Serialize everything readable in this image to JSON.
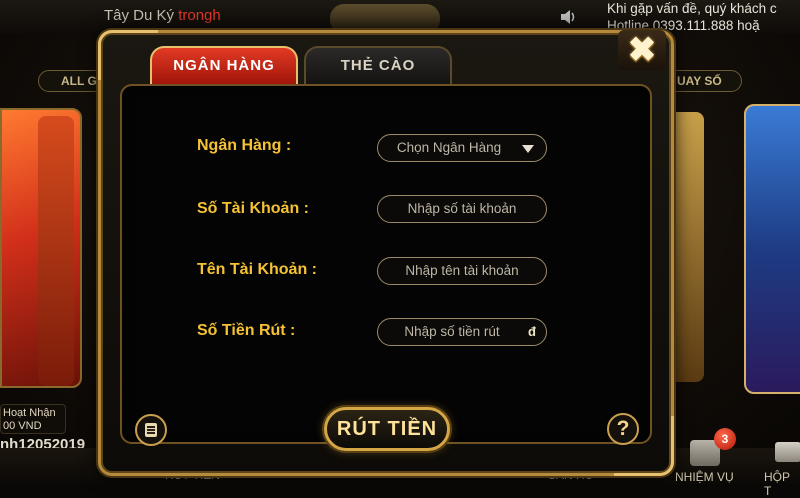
{
  "background": {
    "marquee_text": "Tây Du Ký",
    "marquee_highlight": "trongh",
    "notice_line1": "Khi gặp vấn đề, quý khách c",
    "notice_line2": "Hotline 0393.111.888 hoặ",
    "category_left": "ALL G",
    "category_right": "UAY SỐ",
    "card_caption_line1": "Hoạt Nhận",
    "card_caption_line2": "00 VND",
    "user_id": "nh12052019",
    "nav_left": "RÚT TIỀN",
    "nav_mid": "SĂN HŨ",
    "nav_mission": "NHIỆM VỤ",
    "nav_mail": "HỘP T",
    "mission_badge_count": "3"
  },
  "modal": {
    "tabs": [
      {
        "label": "NGÂN HÀNG",
        "active": true
      },
      {
        "label": "THẺ CÀO",
        "active": false
      }
    ],
    "close_glyph": "✖",
    "form": {
      "bank_label": "Ngân Hàng :",
      "bank_select_value": "Chọn Ngân Hàng",
      "account_number_label": "Số Tài Khoản :",
      "account_number_placeholder": "Nhập số tài  khoản",
      "account_name_label": "Tên Tài Khoản :",
      "account_name_placeholder": "Nhập tên tài khoản",
      "amount_label": "Số Tiền Rút :",
      "amount_placeholder": "Nhập số tiền rút",
      "currency_symbol": "đ"
    },
    "submit_label": "RÚT TIỀN",
    "help_glyph": "?"
  },
  "colors": {
    "accent_gold": "#f5c233",
    "tab_active_red": "#e23a24",
    "frame_gold": "#b58a3c"
  },
  "icons": [
    "speaker-icon",
    "close-icon",
    "chevron-down-icon",
    "document-icon",
    "help-icon",
    "gift-icon",
    "mail-icon"
  ]
}
